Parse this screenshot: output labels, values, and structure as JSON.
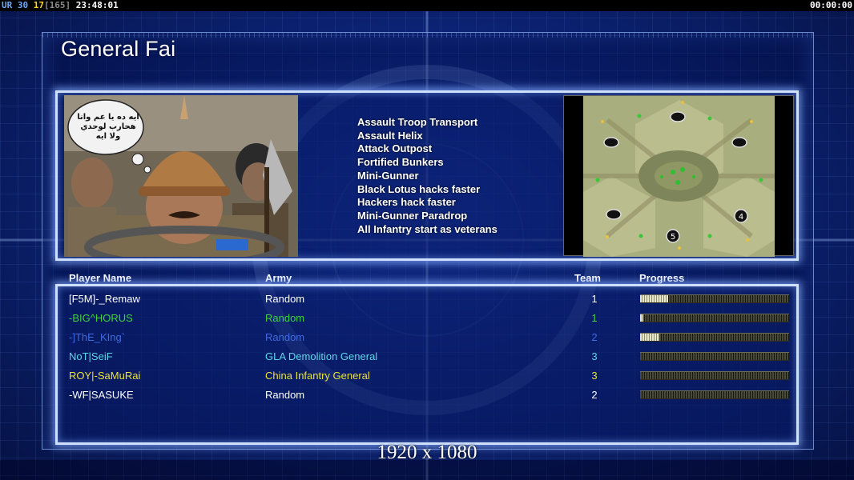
{
  "hud": {
    "ur_label": "UR",
    "ur_value": "30",
    "fps": "17",
    "bracket_value": "[165]",
    "clock": "23:48:01",
    "timer": "00:00:00"
  },
  "general_title": "General Fai",
  "portrait_bubble_text": "ايه ده يا عم وانا هحارب لوحدي ولا ايه",
  "upgrades": [
    "Assault Troop Transport",
    "Assault Helix",
    "Attack Outpost",
    "Fortified Bunkers",
    "Mini-Gunner",
    "Black Lotus hacks faster",
    "Hackers hack faster",
    "Mini-Gunner Paradrop",
    "All Infantry start as veterans"
  ],
  "minimap": {
    "start_markers": [
      "4",
      "5"
    ]
  },
  "columns": {
    "player": "Player Name",
    "army": "Army",
    "team": "Team",
    "progress": "Progress"
  },
  "players": [
    {
      "name": "[F5M]-_Remaw",
      "army": "Random",
      "team": "1",
      "color": "#ffffff",
      "progress": 0.19
    },
    {
      "name": "-BIG^HORUS",
      "army": "Random",
      "team": "1",
      "color": "#3ed23e",
      "progress": 0.02
    },
    {
      "name": "-]ThE_KIng`",
      "army": "Random",
      "team": "2",
      "color": "#3f6be0",
      "progress": 0.13
    },
    {
      "name": "NoT|SeiF",
      "army": "GLA Demolition General",
      "team": "3",
      "color": "#5fd6e6",
      "progress": 0.0
    },
    {
      "name": "ROY|-SaMuRai",
      "army": "China Infantry General",
      "team": "3",
      "color": "#e8e23a",
      "progress": 0.0
    },
    {
      "name": "-WF|SASUKE",
      "army": "Random",
      "team": "2",
      "color": "#ffffff",
      "progress": 0.0
    }
  ],
  "resolution_text": "1920 x 1080"
}
